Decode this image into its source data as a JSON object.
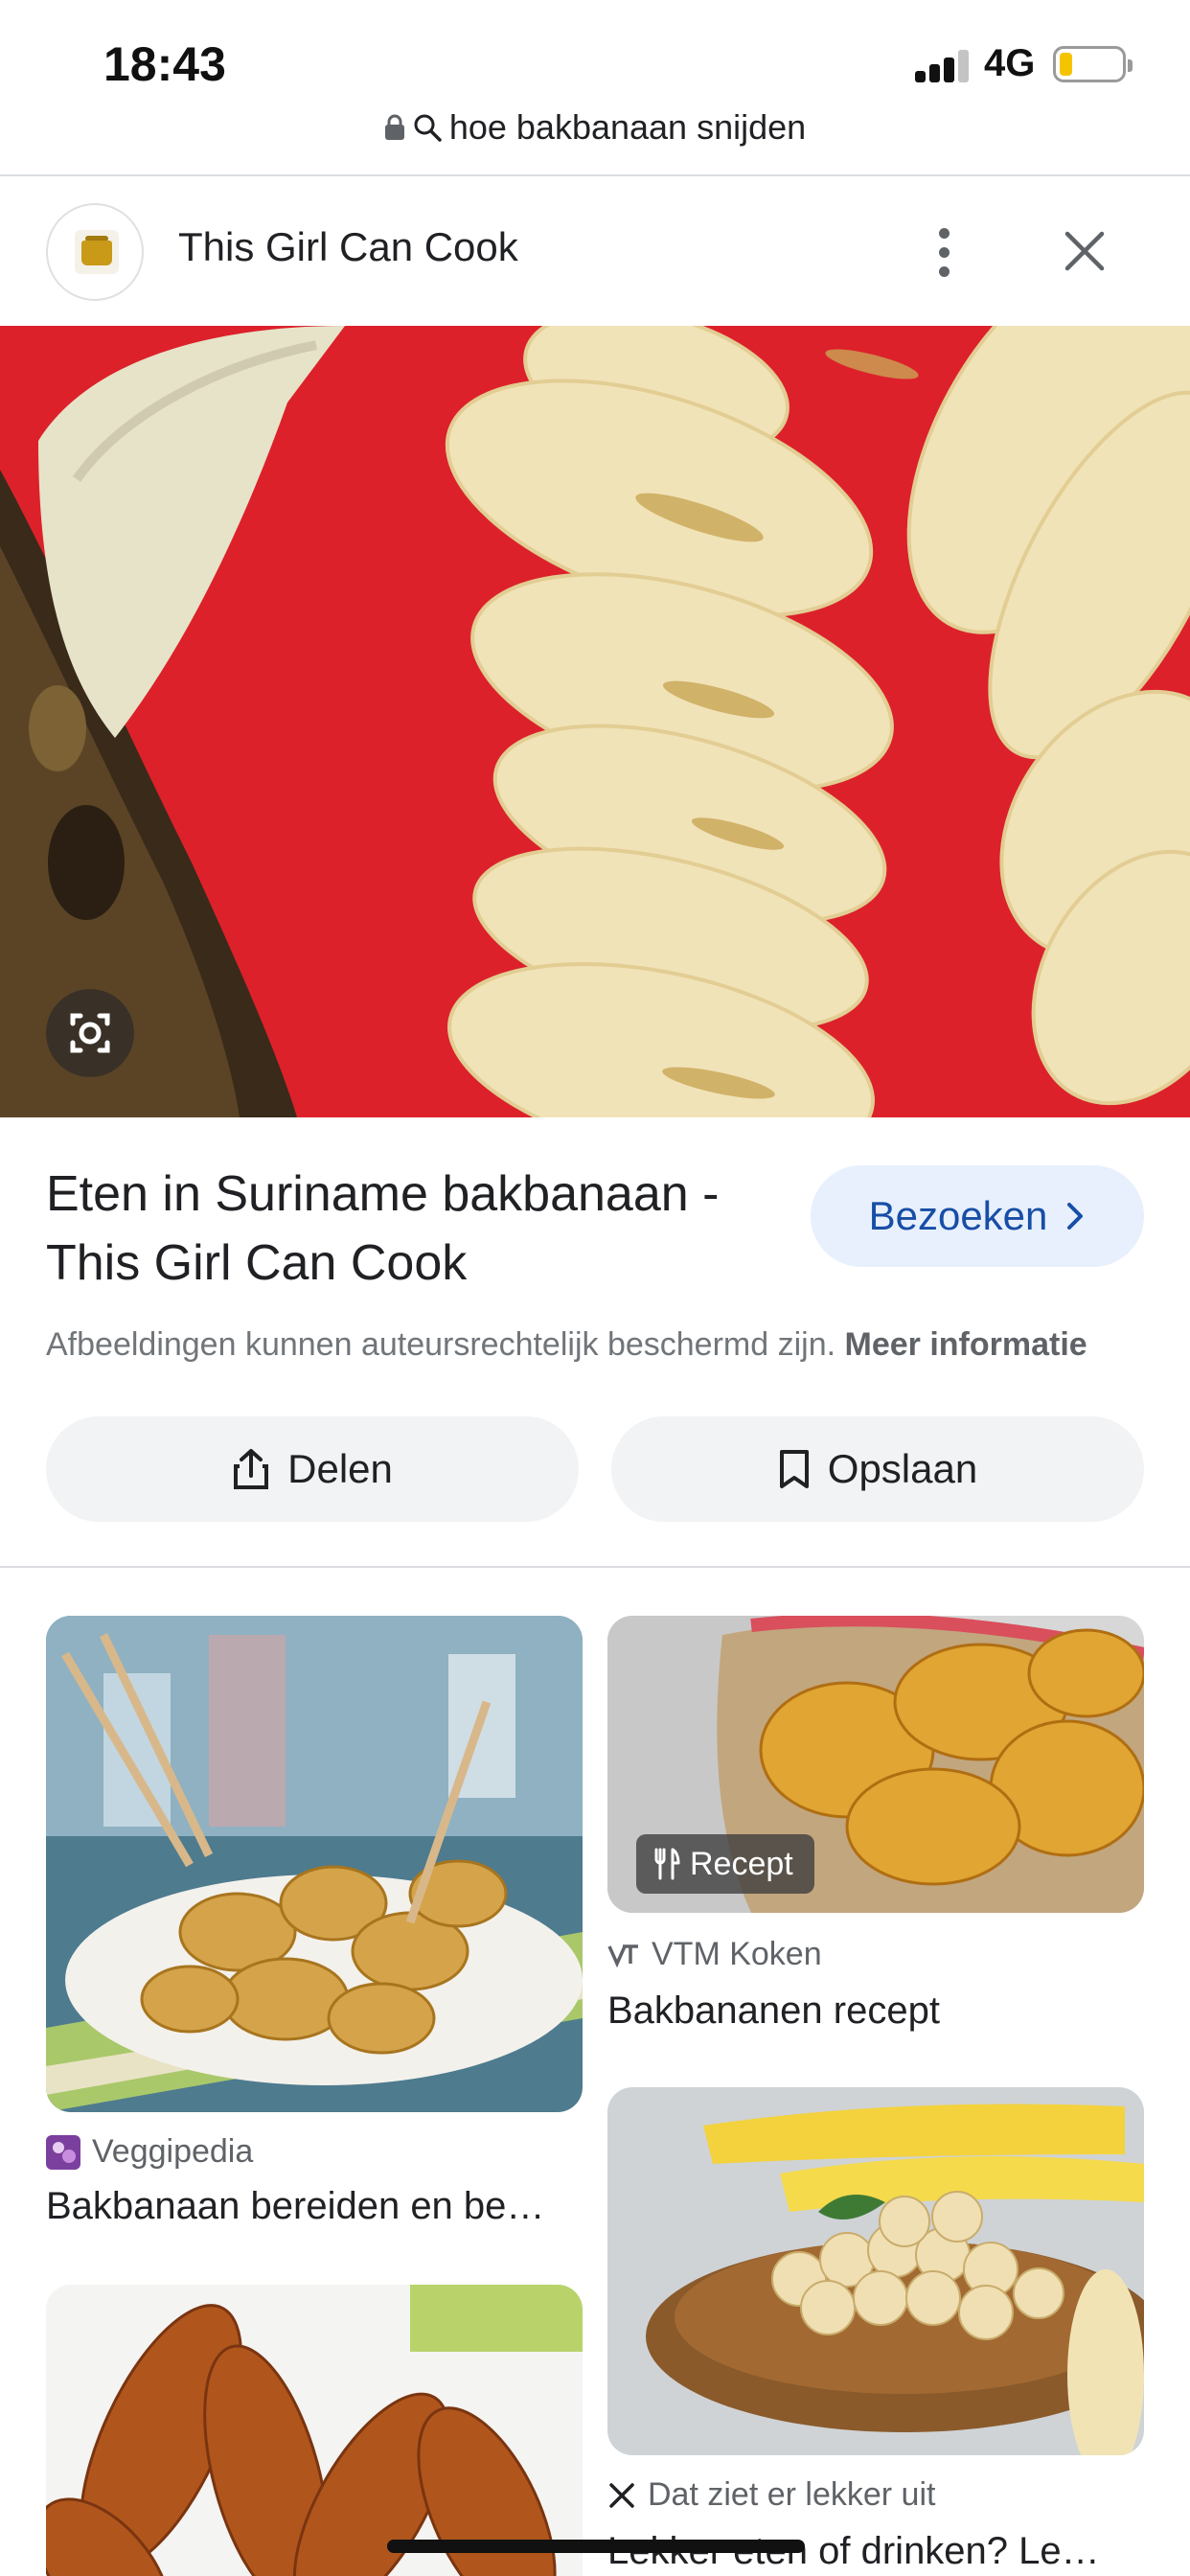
{
  "status_bar": {
    "time": "18:43",
    "network": "4G"
  },
  "url_bar": {
    "query": "hoe bakbanaan snijden"
  },
  "site": {
    "name": "This Girl Can Cook"
  },
  "result": {
    "title": "Eten in Suriname bakbanaan - This Girl Can Cook",
    "visit_label": "Bezoeken",
    "copyright_text": "Afbeeldingen kunnen auteursrechtelijk beschermd zijn.",
    "more_info_label": "Meer informatie",
    "share_label": "Delen",
    "save_label": "Opslaan"
  },
  "related": [
    {
      "source": "Veggipedia",
      "title": "Bakbanaan bereiden en be…"
    },
    {
      "source": "VTM Koken",
      "title": "Bakbananen recept",
      "badge": "Recept"
    },
    {
      "source": "Dat ziet er lekker uit",
      "title": "Lekker eten of drinken? Le…"
    }
  ],
  "icons": {
    "lock": "lock-icon",
    "search": "search-icon",
    "more": "more-vert-icon",
    "close": "close-icon",
    "lens": "google-lens-icon",
    "chevron": "chevron-right-icon",
    "share": "share-icon",
    "bookmark": "bookmark-icon",
    "recipe": "fork-knife-icon"
  },
  "colors": {
    "accent": "#174ea6",
    "visit_bg": "#e8f0fe",
    "button_bg": "#f1f3f4",
    "hero_bg": "#e3232c",
    "battery": "#f5c400"
  }
}
